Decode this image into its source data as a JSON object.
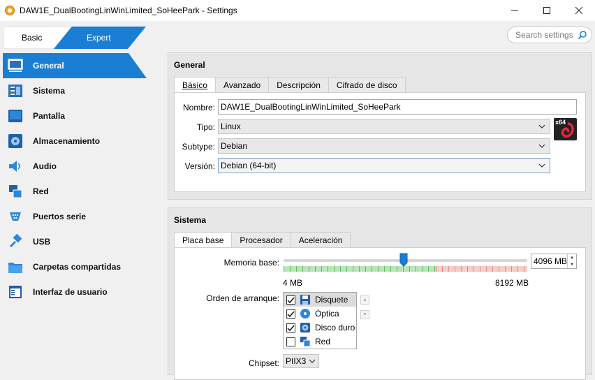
{
  "window": {
    "title": "DAW1E_DualBootingLinWinLimited_SoHeePark - Settings",
    "controls": [
      "minimize",
      "maximize",
      "close"
    ]
  },
  "mode_tabs": {
    "basic": "Basic",
    "expert": "Expert",
    "active": "expert"
  },
  "search": {
    "placeholder": "Search settings"
  },
  "sidebar": {
    "items": [
      {
        "label": "General",
        "icon": "general-icon",
        "active": true
      },
      {
        "label": "Sistema",
        "icon": "system-icon"
      },
      {
        "label": "Pantalla",
        "icon": "display-icon"
      },
      {
        "label": "Almacenamiento",
        "icon": "storage-icon"
      },
      {
        "label": "Audio",
        "icon": "audio-icon"
      },
      {
        "label": "Red",
        "icon": "network-icon"
      },
      {
        "label": "Puertos serie",
        "icon": "serial-ports-icon"
      },
      {
        "label": "USB",
        "icon": "usb-icon"
      },
      {
        "label": "Carpetas compartidas",
        "icon": "shared-folders-icon"
      },
      {
        "label": "Interfaz de usuario",
        "icon": "user-interface-icon"
      }
    ]
  },
  "general": {
    "title": "General",
    "tabs": [
      "Básico",
      "Avanzado",
      "Descripción",
      "Cifrado de disco"
    ],
    "fields": {
      "name_label": "Nombre:",
      "name_value": "DAW1E_DualBootingLinWinLimited_SoHeePark",
      "type_label": "Tipo:",
      "type_value": "Linux",
      "subtype_label": "Subtype:",
      "subtype_value": "Debian",
      "version_label": "Versión:",
      "version_value": "Debian (64-bit)",
      "os_badge": "x64"
    }
  },
  "system": {
    "title": "Sistema",
    "tabs": [
      "Placa base",
      "Procesador",
      "Aceleración"
    ],
    "memory_label": "Memoria base:",
    "memory_value": "4096 MB",
    "memory_min": "4 MB",
    "memory_max": "8192 MB",
    "memory_fraction": 0.5,
    "boot_order_label": "Orden de arranque:",
    "boot_items": [
      {
        "label": "Disquete",
        "checked": true,
        "icon": "floppy-icon"
      },
      {
        "label": "Óptica",
        "checked": true,
        "icon": "optical-disc-icon"
      },
      {
        "label": "Disco duro",
        "checked": true,
        "icon": "hard-disk-icon"
      },
      {
        "label": "Red",
        "checked": false,
        "icon": "network-boot-icon"
      }
    ],
    "chipset_label": "Chipset:",
    "chipset_value": "PIIX3"
  },
  "colors": {
    "accent": "#1e8ee8",
    "sidebar_active": "#1a7fd4",
    "slider_green": "#7ed07e",
    "slider_red": "#f0a8a0"
  }
}
